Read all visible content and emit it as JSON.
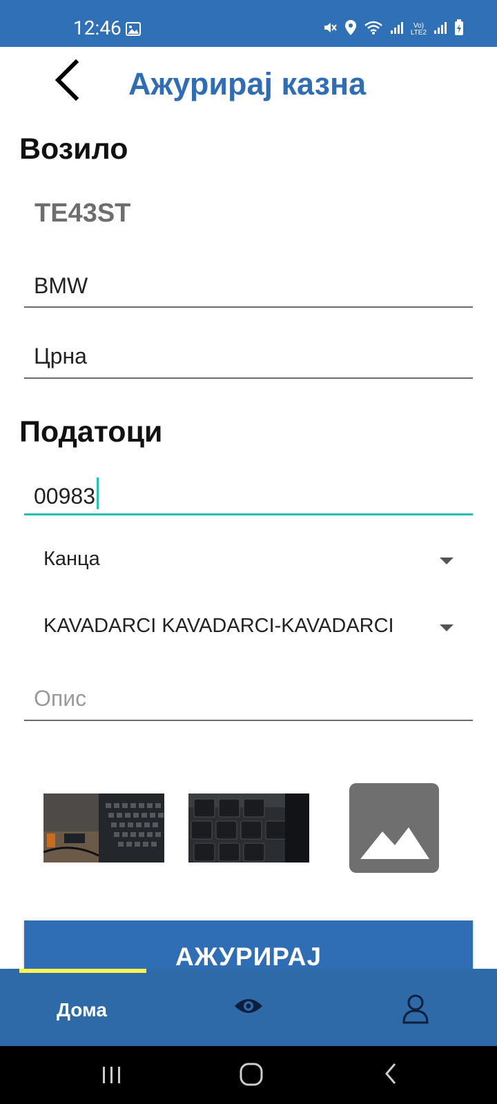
{
  "status_bar": {
    "time": "12:46"
  },
  "header": {
    "title": "Ажурирај казна"
  },
  "vehicle": {
    "section_title": "Возило",
    "plate": "TE43ST",
    "brand": "BMW",
    "color": "Црна"
  },
  "details": {
    "section_title": "Податоци",
    "number_value": "00983",
    "type_selected": "Канца",
    "location_selected": "KAVADARCI KAVADARCI-KAVADARCI",
    "description_placeholder": "Опис"
  },
  "update_button": {
    "label": "АЖУРИРАЈ"
  },
  "bottom_nav": {
    "home_label": "Дома"
  },
  "colors": {
    "primary": "#2f6db4",
    "accent": "#26bfb6",
    "indicator": "#fff44f"
  }
}
